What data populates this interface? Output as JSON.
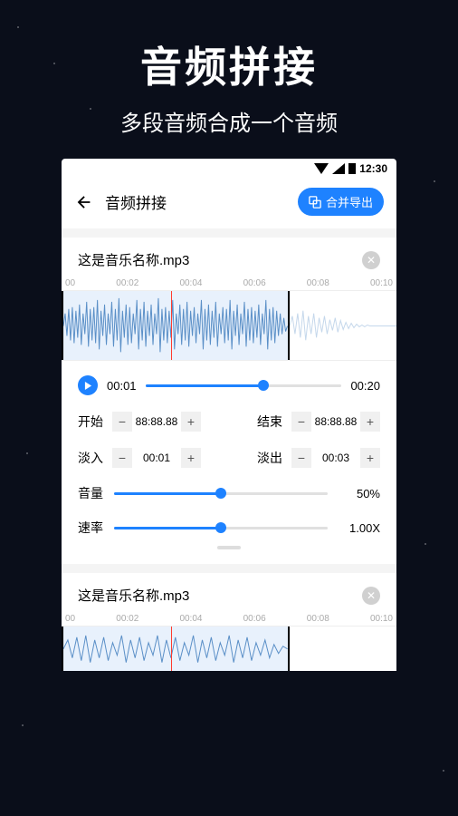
{
  "hero": {
    "title": "音频拼接",
    "subtitle": "多段音频合成一个音频"
  },
  "statusbar": {
    "time": "12:30"
  },
  "appbar": {
    "title": "音频拼接",
    "export_label": "合并导出"
  },
  "track1": {
    "filename": "这是音乐名称.mp3",
    "timeline": [
      "00",
      "00:02",
      "00:04",
      "00:06",
      "00:08",
      "00:10"
    ],
    "play_current": "00:01",
    "play_total": "00:20",
    "start_label": "开始",
    "start_value": "88:88.88",
    "end_label": "结束",
    "end_value": "88:88.88",
    "fadein_label": "淡入",
    "fadein_value": "00:01",
    "fadeout_label": "淡出",
    "fadeout_value": "00:03",
    "volume_label": "音量",
    "volume_value": "50%",
    "volume_pct": 50,
    "speed_label": "速率",
    "speed_value": "1.00X",
    "speed_pct": 50
  },
  "track2": {
    "filename": "这是音乐名称.mp3",
    "timeline": [
      "00",
      "00:02",
      "00:04",
      "00:06",
      "00:08",
      "00:10"
    ]
  }
}
